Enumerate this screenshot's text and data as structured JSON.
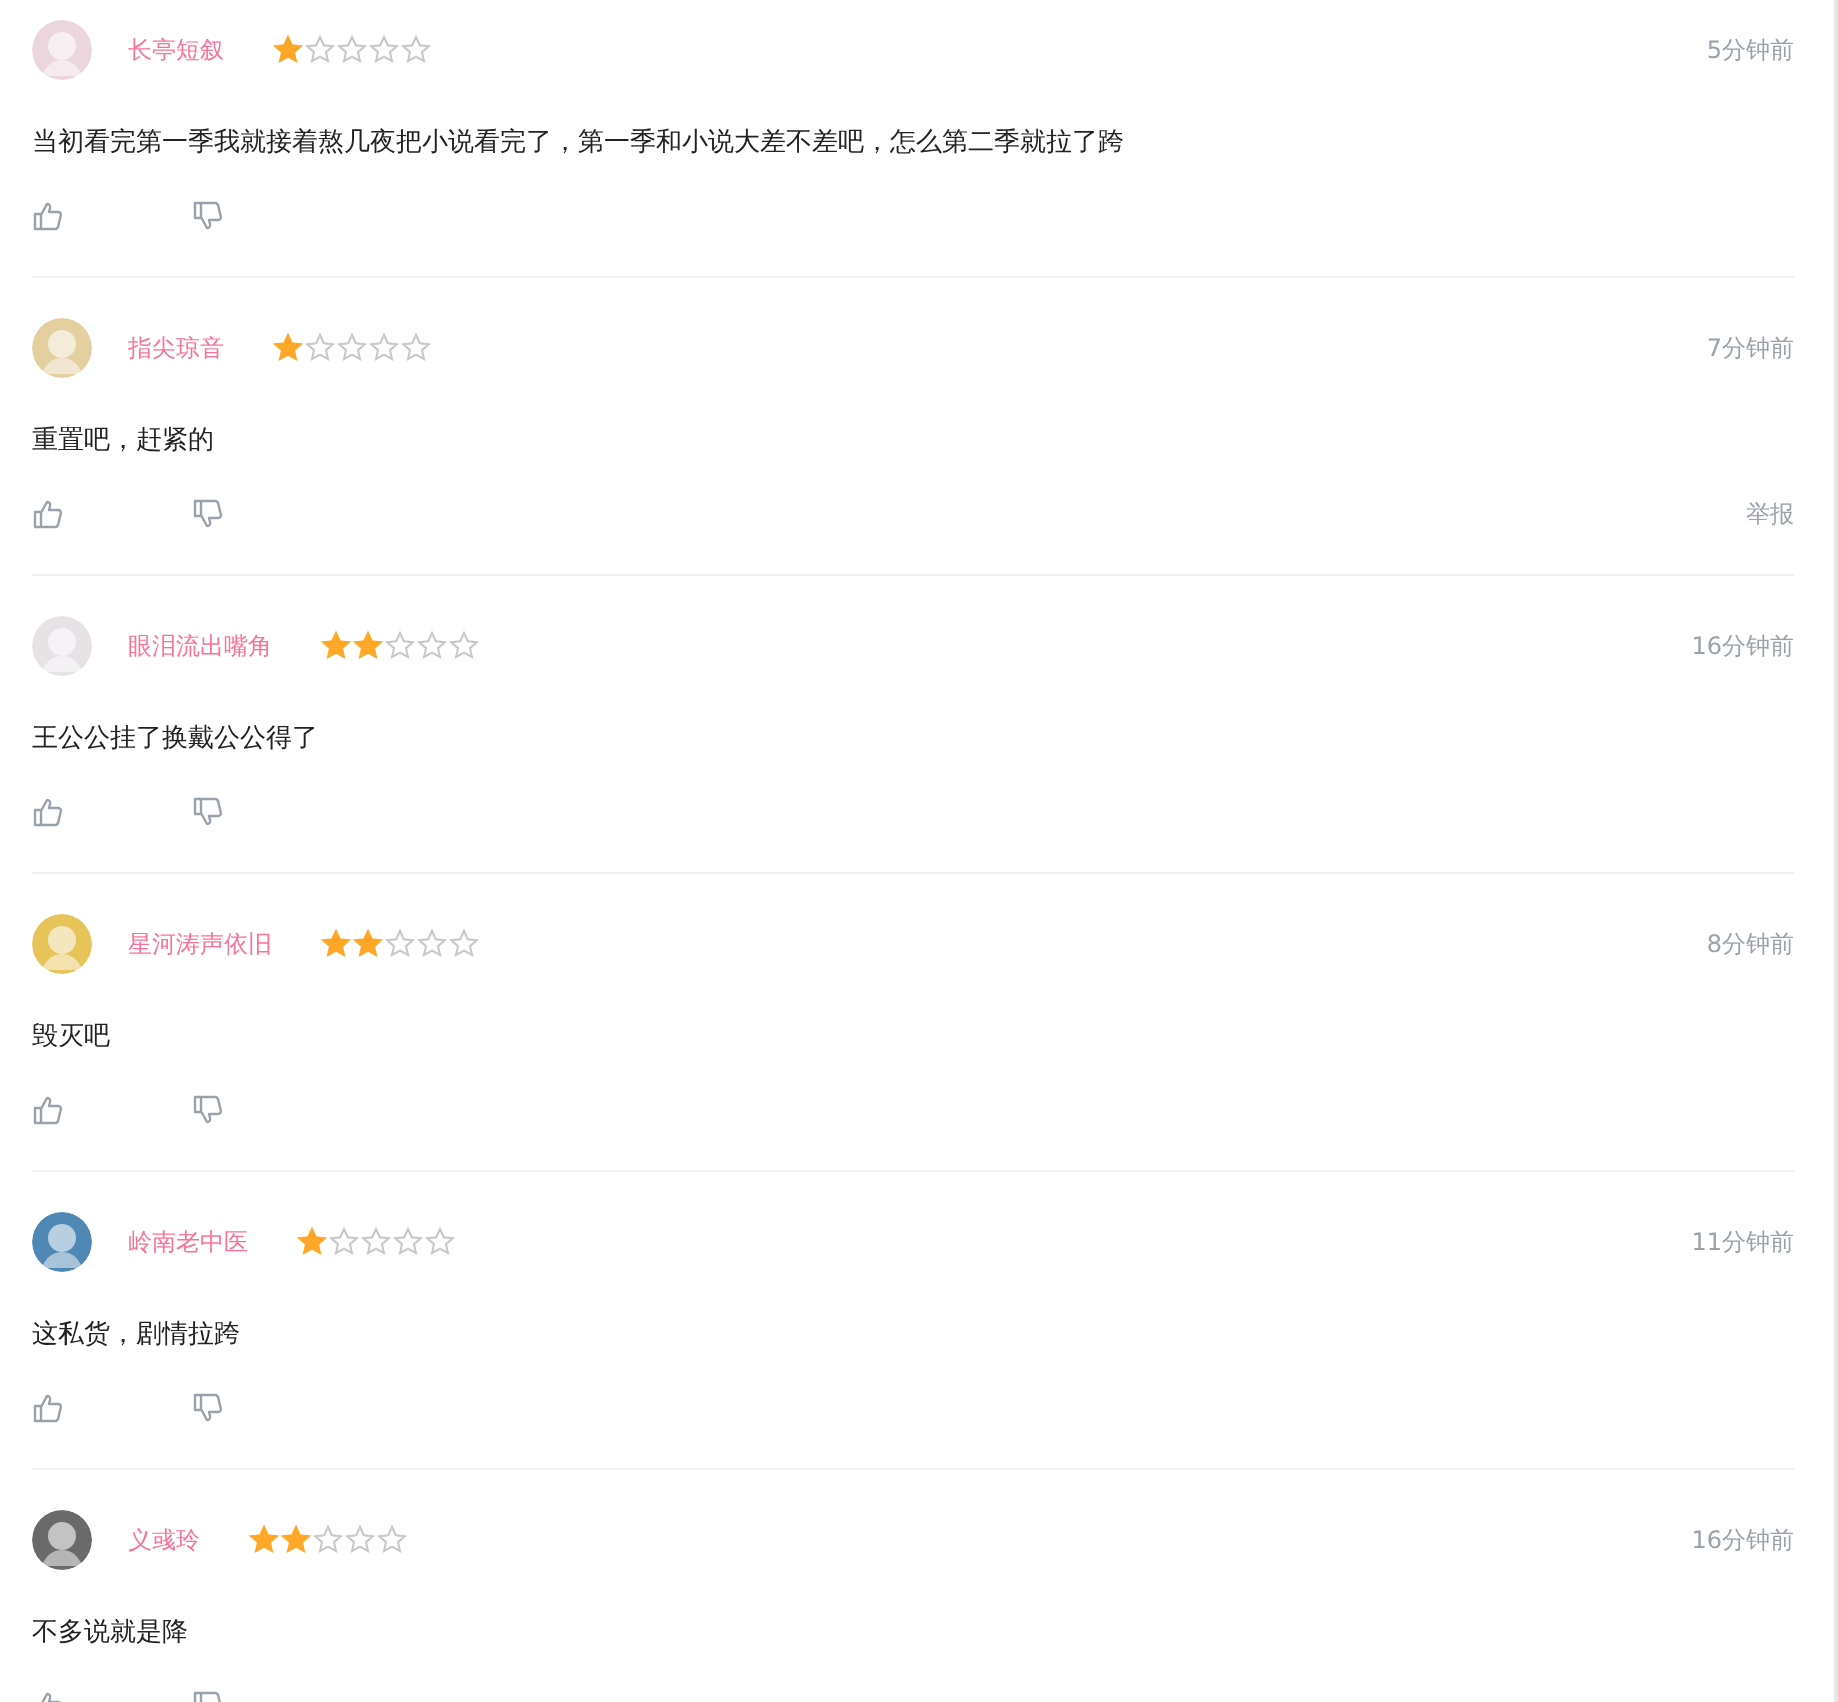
{
  "comments": [
    {
      "user": "长亭短叙",
      "stars": 1,
      "time": "5分钟前",
      "text": "当初看完第一季我就接着熬几夜把小说看完了，第一季和小说大差不差吧，怎么第二季就拉了跨"
    },
    {
      "user": "指尖琼音",
      "stars": 1,
      "time": "7分钟前",
      "text": "重置吧，赶紧的",
      "report": "举报"
    },
    {
      "user": "眼泪流出嘴角",
      "stars": 2,
      "time": "16分钟前",
      "text": "王公公挂了换戴公公得了"
    },
    {
      "user": "星河涛声依旧",
      "stars": 2,
      "time": "8分钟前",
      "text": "毁灭吧"
    },
    {
      "user": "岭南老中医",
      "stars": 1,
      "time": "11分钟前",
      "text": "这私货，剧情拉跨"
    },
    {
      "user": "义彧玲",
      "stars": 2,
      "time": "16分钟前",
      "text": "不多说就是降"
    }
  ]
}
